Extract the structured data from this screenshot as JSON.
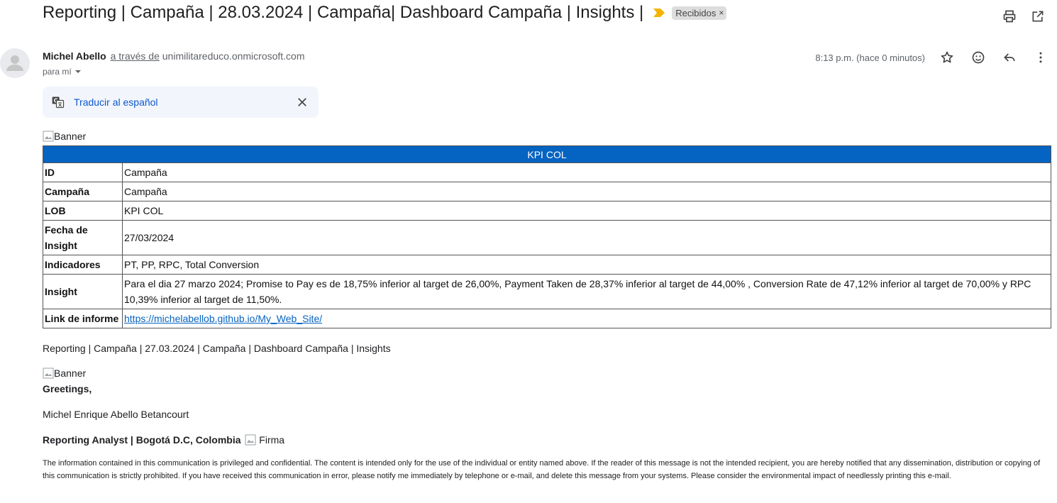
{
  "subject": "Reporting | Campaña | 28.03.2024 | Campaña| Dashboard Campaña | Insights |",
  "label_chip": "Recibidos",
  "label_close": "×",
  "sender": {
    "name": "Michel Abello",
    "via": "a través de",
    "domain": "unimilitareduco.onmicrosoft.com",
    "to": "para mí"
  },
  "time": "8:13 p.m. (hace 0 minutos)",
  "translate_label": "Traducir al español",
  "banner_alt": "Banner",
  "table": {
    "header": "KPI COL",
    "rows": [
      {
        "key": "ID",
        "value": "Campaña"
      },
      {
        "key": "Campaña",
        "value": "Campaña"
      },
      {
        "key": "LOB",
        "value": "KPI COL"
      },
      {
        "key": "Fecha de Insight",
        "value": "27/03/2024"
      },
      {
        "key": "Indicadores",
        "value": "PT, PP, RPC, Total Conversion"
      },
      {
        "key": "Insight",
        "value": "Para el dia 27 marzo 2024; Promise to Pay es de 18,75% inferior al target de 26,00%, Payment Taken de 28,37% inferior al target de 44,00% , Conversion Rate de 47,12% inferior al target de 70,00% y RPC 10,39% inferior al target de 11,50%."
      },
      {
        "key": "Link de informe",
        "value": "https://michelabellob.github.io/My_Web_Site/"
      }
    ]
  },
  "body_subject": "Reporting | Campaña | 27.03.2024 | Campaña | Dashboard Campaña | Insights",
  "greeting": "Greetings,",
  "signature_name": "Michel Enrique Abello Betancourt",
  "signature_title": "Reporting Analyst | Bogotá D.C, Colombia",
  "signature_img_alt": "Firma",
  "disclaimer": "The information contained in this communication is privileged and confidential. The content is intended only for the use of the individual or entity named above. If the reader of this message is not the intended recipient, you are hereby notified that any dissemination, distribution or copying of this communication is strictly prohibited. If you have received this communication in error, please notify me immediately by telephone or e-mail, and delete this message from your systems. Please consider the environmental impact of needlessly printing this e-mail.",
  "icons": {
    "print": "print-icon",
    "open_new": "open-in-new-window-icon",
    "star": "star-icon",
    "emoji": "emoji-icon",
    "reply": "reply-icon",
    "more": "more-vert-icon",
    "translate": "translate-icon",
    "close": "close-icon",
    "importance": "importance-marker-icon"
  },
  "colors": {
    "table_header": "#0563c1",
    "link": "#0b57d0",
    "importance": "#f4b400"
  }
}
